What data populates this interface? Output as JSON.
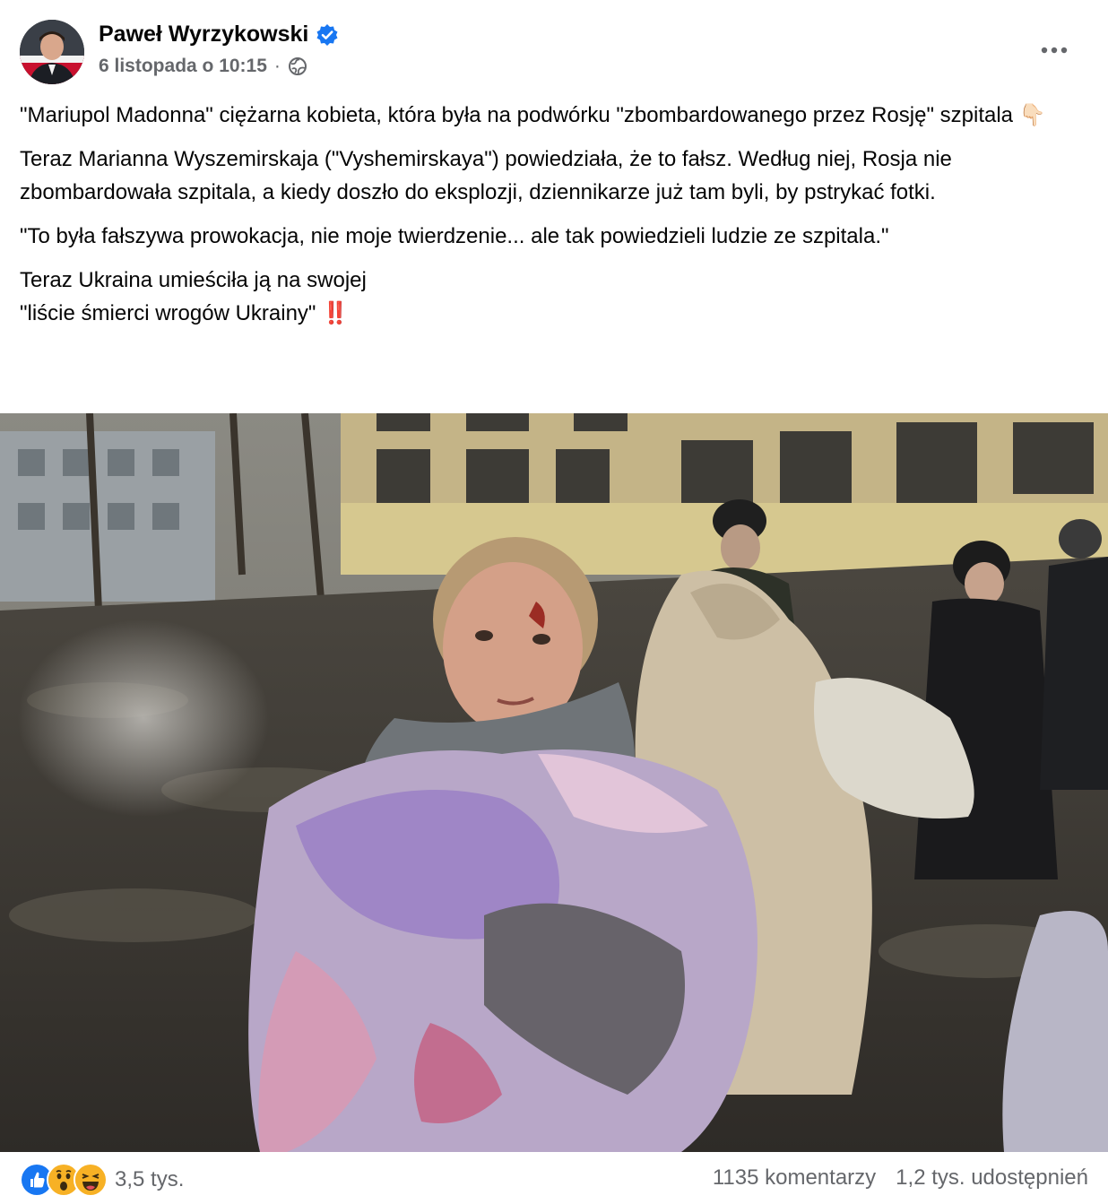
{
  "post": {
    "author": "Paweł Wyrzykowski",
    "timestamp": "6 listopada o 10:15",
    "separator": "·",
    "privacy_icon": "globe-icon",
    "verified_icon": "verified-badge-icon",
    "more_icon": "more-horizontal-icon",
    "paragraphs": [
      "\"Mariupol Madonna\" ciężarna kobieta, która była na podwórku \"zbombardowanego przez Rosję\" szpitala 👇🏻",
      "Teraz Marianna Wyszemirskaja (\"Vyshemirskaya\") powiedziała, że to fałsz. Według niej, Rosja nie zbombardowała szpitala, a kiedy doszło do eksplozji, dziennikarze już tam byli, by pstrykać fotki.",
      "\"To była fałszywa prowokacja, nie moje twierdzenie... ale tak powiedzieli ludzie ze szpitala.\"",
      "Teraz Ukraina umieściła ją na swojej\n \"liście śmierci wrogów Ukrainy\" ‼️"
    ]
  },
  "footer": {
    "reaction_icons": [
      "like-reaction-icon",
      "wow-reaction-icon",
      "haha-reaction-icon"
    ],
    "reaction_count": "3,5 tys.",
    "comments": "1135 komentarzy",
    "shares": "1,2 tys. udostępnień"
  },
  "colors": {
    "text": "#050505",
    "secondary": "#65676b",
    "verified": "#1877f2",
    "like": "#1877f2",
    "wow": "#f7b125"
  }
}
